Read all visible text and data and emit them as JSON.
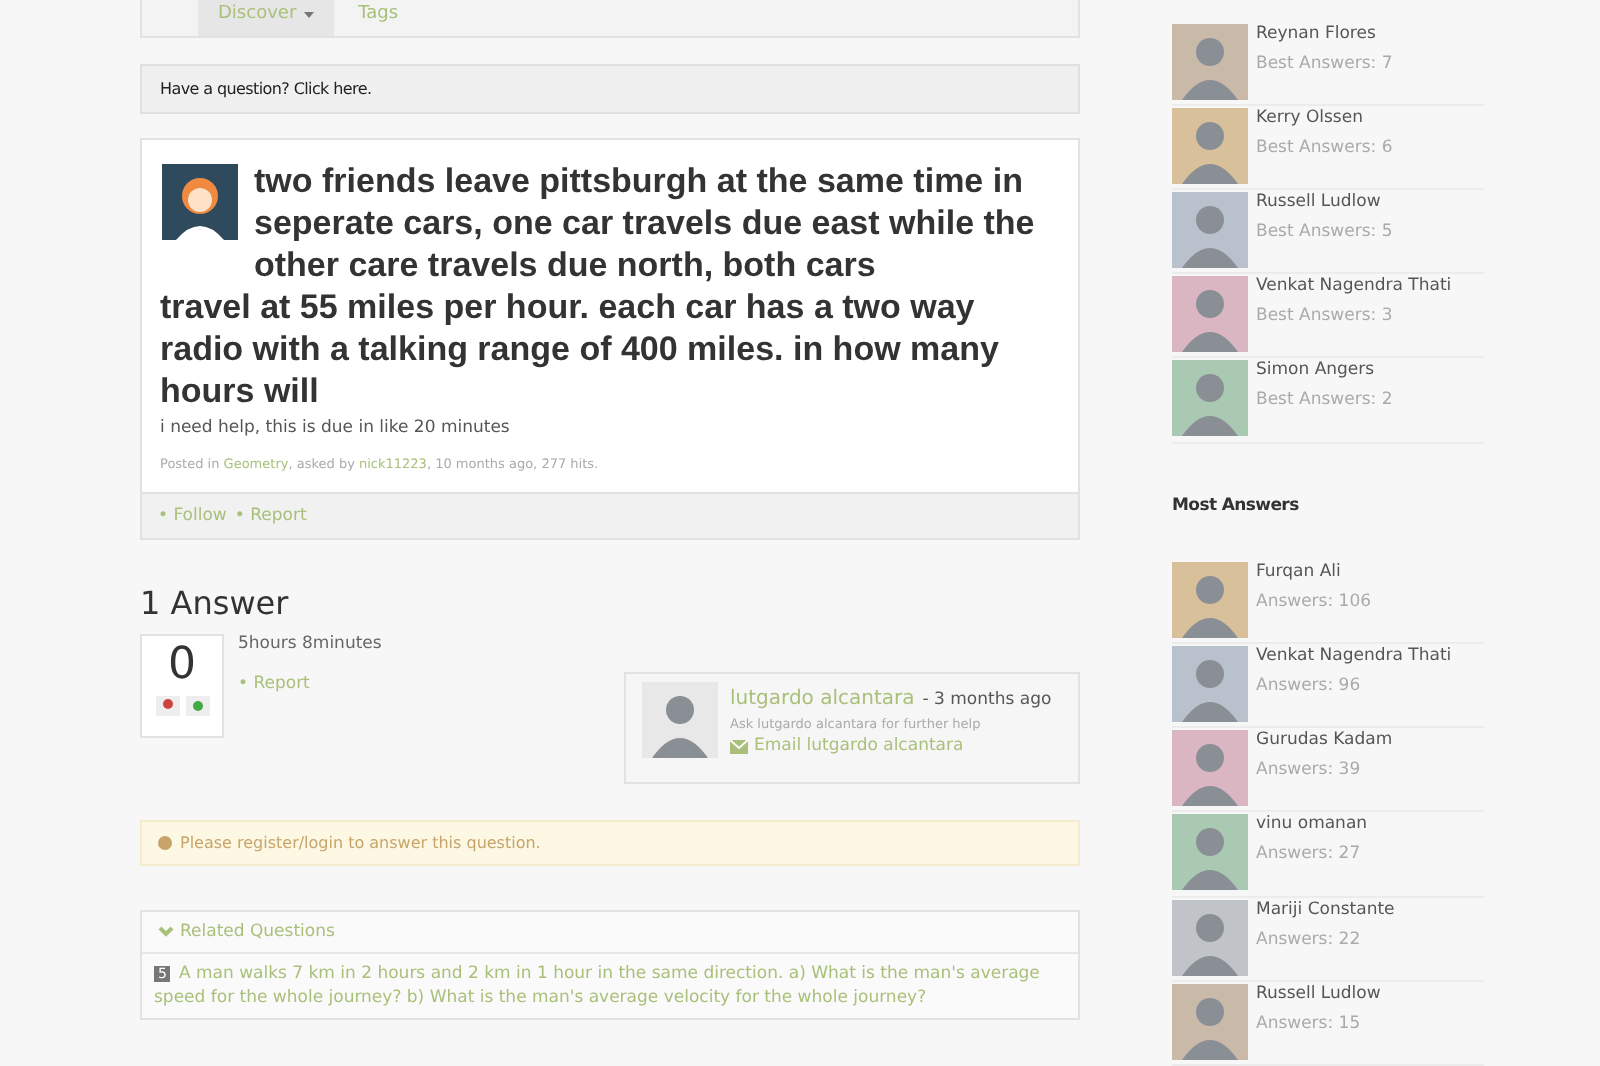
{
  "nav": {
    "tabs": [
      {
        "label": "Discover",
        "selected": true,
        "caret": true
      },
      {
        "label": "Tags",
        "selected": false,
        "caret": false
      }
    ]
  },
  "ask_bar": {
    "label": "Have a question? Click here."
  },
  "question": {
    "title": [
      "two friends leave pittsburgh at the same time in seperate cars, one car travels due east while the other care travels due north, both cars",
      "travel at 55 miles per hour. each car has a two way radio with a talking range of 400 miles. in how many hours will"
    ],
    "body": "i need help, this is due in like 20 minutes",
    "meta": {
      "prefix": "Posted in",
      "category": "Geometry",
      "asked_by": ", asked by",
      "user": "nick11223",
      "suffix": ", 10 months ago, 277 hits."
    },
    "actions": [
      "• Follow",
      "• Report"
    ]
  },
  "answers_heading": "1 Answer",
  "answer": {
    "votes": "0",
    "time": "5hours 8minutes",
    "actions": [
      "• Report"
    ],
    "author": {
      "name": "lutgardo alcantara",
      "ago": "- 3 months ago",
      "note": "Ask lutgardo alcantara for further help",
      "email": "Email lutgardo alcantara"
    }
  },
  "alert": "Please register/login to answer this question.",
  "related": {
    "heading": "Related Questions",
    "items": [
      {
        "count": "5",
        "text": "A man walks 7 km in 2 hours and 2 km in 1 hour in the same direction. a) What is the man's average speed for the whole journey? b) What is the man's average velocity for the whole journey?"
      }
    ]
  },
  "best_answers": [
    {
      "name": "Reynan Flores",
      "stat": "Best Answers: 7"
    },
    {
      "name": "Kerry Olssen",
      "stat": "Best Answers: 6"
    },
    {
      "name": "Russell Ludlow",
      "stat": "Best Answers: 5"
    },
    {
      "name": "Venkat Nagendra Thati",
      "stat": "Best Answers: 3"
    },
    {
      "name": "Simon Angers",
      "stat": "Best Answers: 2"
    }
  ],
  "most_answers": {
    "heading": "Most Answers",
    "users": [
      {
        "name": "Furqan Ali",
        "stat": "Answers: 106"
      },
      {
        "name": "Venkat Nagendra Thati",
        "stat": "Answers: 96"
      },
      {
        "name": "Gurudas Kadam",
        "stat": "Answers: 39"
      },
      {
        "name": "vinu omanan",
        "stat": "Answers: 27"
      },
      {
        "name": "Mariji Constante",
        "stat": "Answers: 22"
      },
      {
        "name": "Russell Ludlow",
        "stat": "Answers: 15"
      }
    ]
  }
}
